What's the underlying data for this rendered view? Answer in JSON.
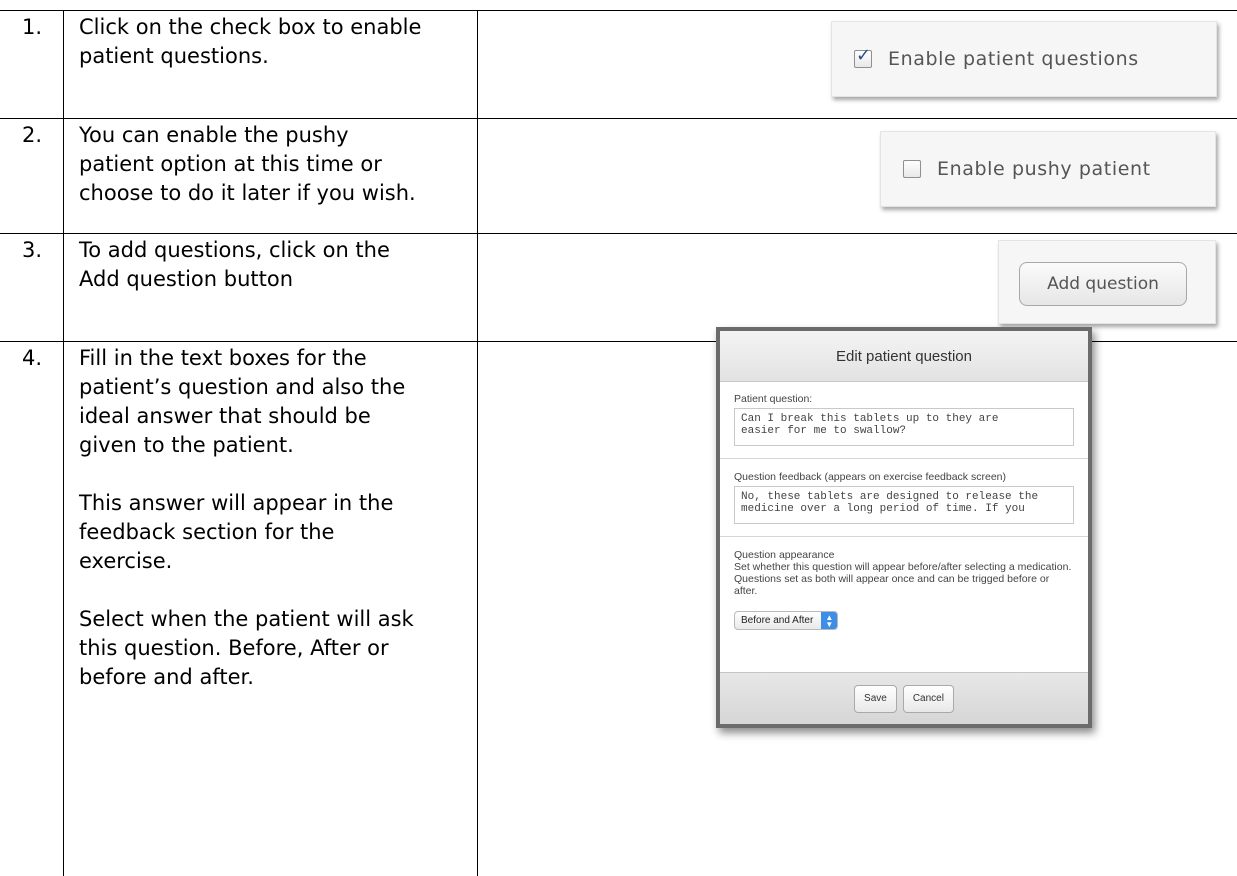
{
  "rows": [
    {
      "number": "1.",
      "text": [
        "Click on the check box to enable",
        "patient questions."
      ],
      "checkbox_label": "Enable patient questions",
      "checked": true
    },
    {
      "number": "2.",
      "text": [
        "You can enable the pushy",
        "patient option at this time or",
        "choose to do it later if you wish."
      ],
      "checkbox_label": "Enable pushy patient",
      "checked": false
    },
    {
      "number": "3.",
      "text": [
        "To add questions, click on the",
        "Add question button"
      ],
      "button_label": "Add question"
    },
    {
      "number": "4.",
      "paragraphs": [
        [
          "Fill in the text boxes for the",
          "patient’s question and also the",
          "ideal answer that should be",
          "given to the patient."
        ],
        [
          "This answer will appear in the",
          "feedback section for the",
          "exercise."
        ],
        [
          "Select when the patient will ask",
          "this question. Before, After or",
          "before and after."
        ]
      ]
    }
  ],
  "dialog": {
    "title": "Edit patient question",
    "patient_question_label": "Patient question:",
    "patient_question_value": "Can I break this tablets up to they are\neasier for me to swallow?",
    "feedback_label": "Question feedback (appears on exercise feedback screen)",
    "feedback_value": "No, these tablets are designed to release the\nmedicine over a long period of time. If you",
    "appearance_label": "Question appearance",
    "appearance_help_1": "Set whether this question will appear before/after selecting a medication.",
    "appearance_help_2": "Questions set as both will appear once and can be trigged before or after.",
    "appearance_selected": "Before and After",
    "save_label": "Save",
    "cancel_label": "Cancel"
  }
}
